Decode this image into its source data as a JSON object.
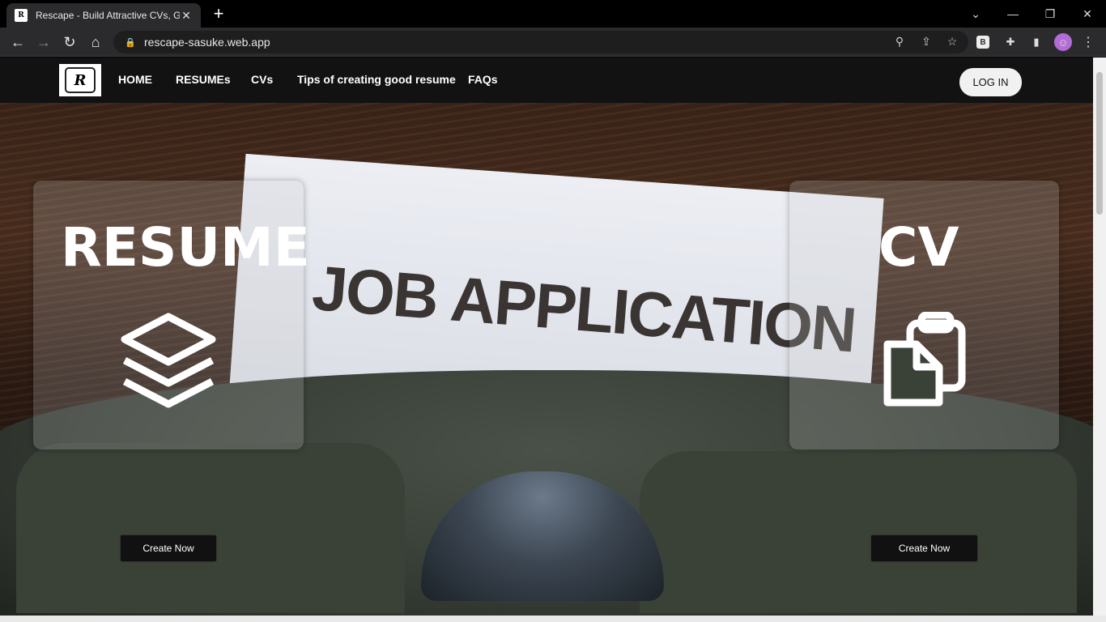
{
  "browser": {
    "tab_title": "Rescape - Build Attractive CVs, Get",
    "tab_favicon": "R",
    "url": "rescape-sasuke.web.app",
    "icons": [
      "back-icon",
      "forward-icon",
      "reload-icon",
      "home-icon",
      "lock-icon",
      "zoom-icon",
      "share-icon",
      "bookmark-star-icon",
      "extension-b-icon",
      "puzzle-icon",
      "sidebar-icon",
      "profile-avatar-icon",
      "menu-kebab-icon"
    ],
    "extension_b": "B"
  },
  "nav": {
    "logo_text": "R",
    "links": [
      "HOME",
      "RESUMEs",
      "CVs",
      "Tips of creating good resume",
      "FAQs"
    ],
    "login_label": "LOG IN"
  },
  "hero": {
    "background_text": "JOB APPLICATION",
    "resume": {
      "title": "RESUME",
      "icon": "layers-icon",
      "button": "Create Now"
    },
    "cv": {
      "title": "CV",
      "icon": "clipboard-icon",
      "button": "Create Now"
    }
  },
  "colors": {
    "navbar": "#121212",
    "accent_white": "#ffffff",
    "button_bg": "#111111"
  }
}
